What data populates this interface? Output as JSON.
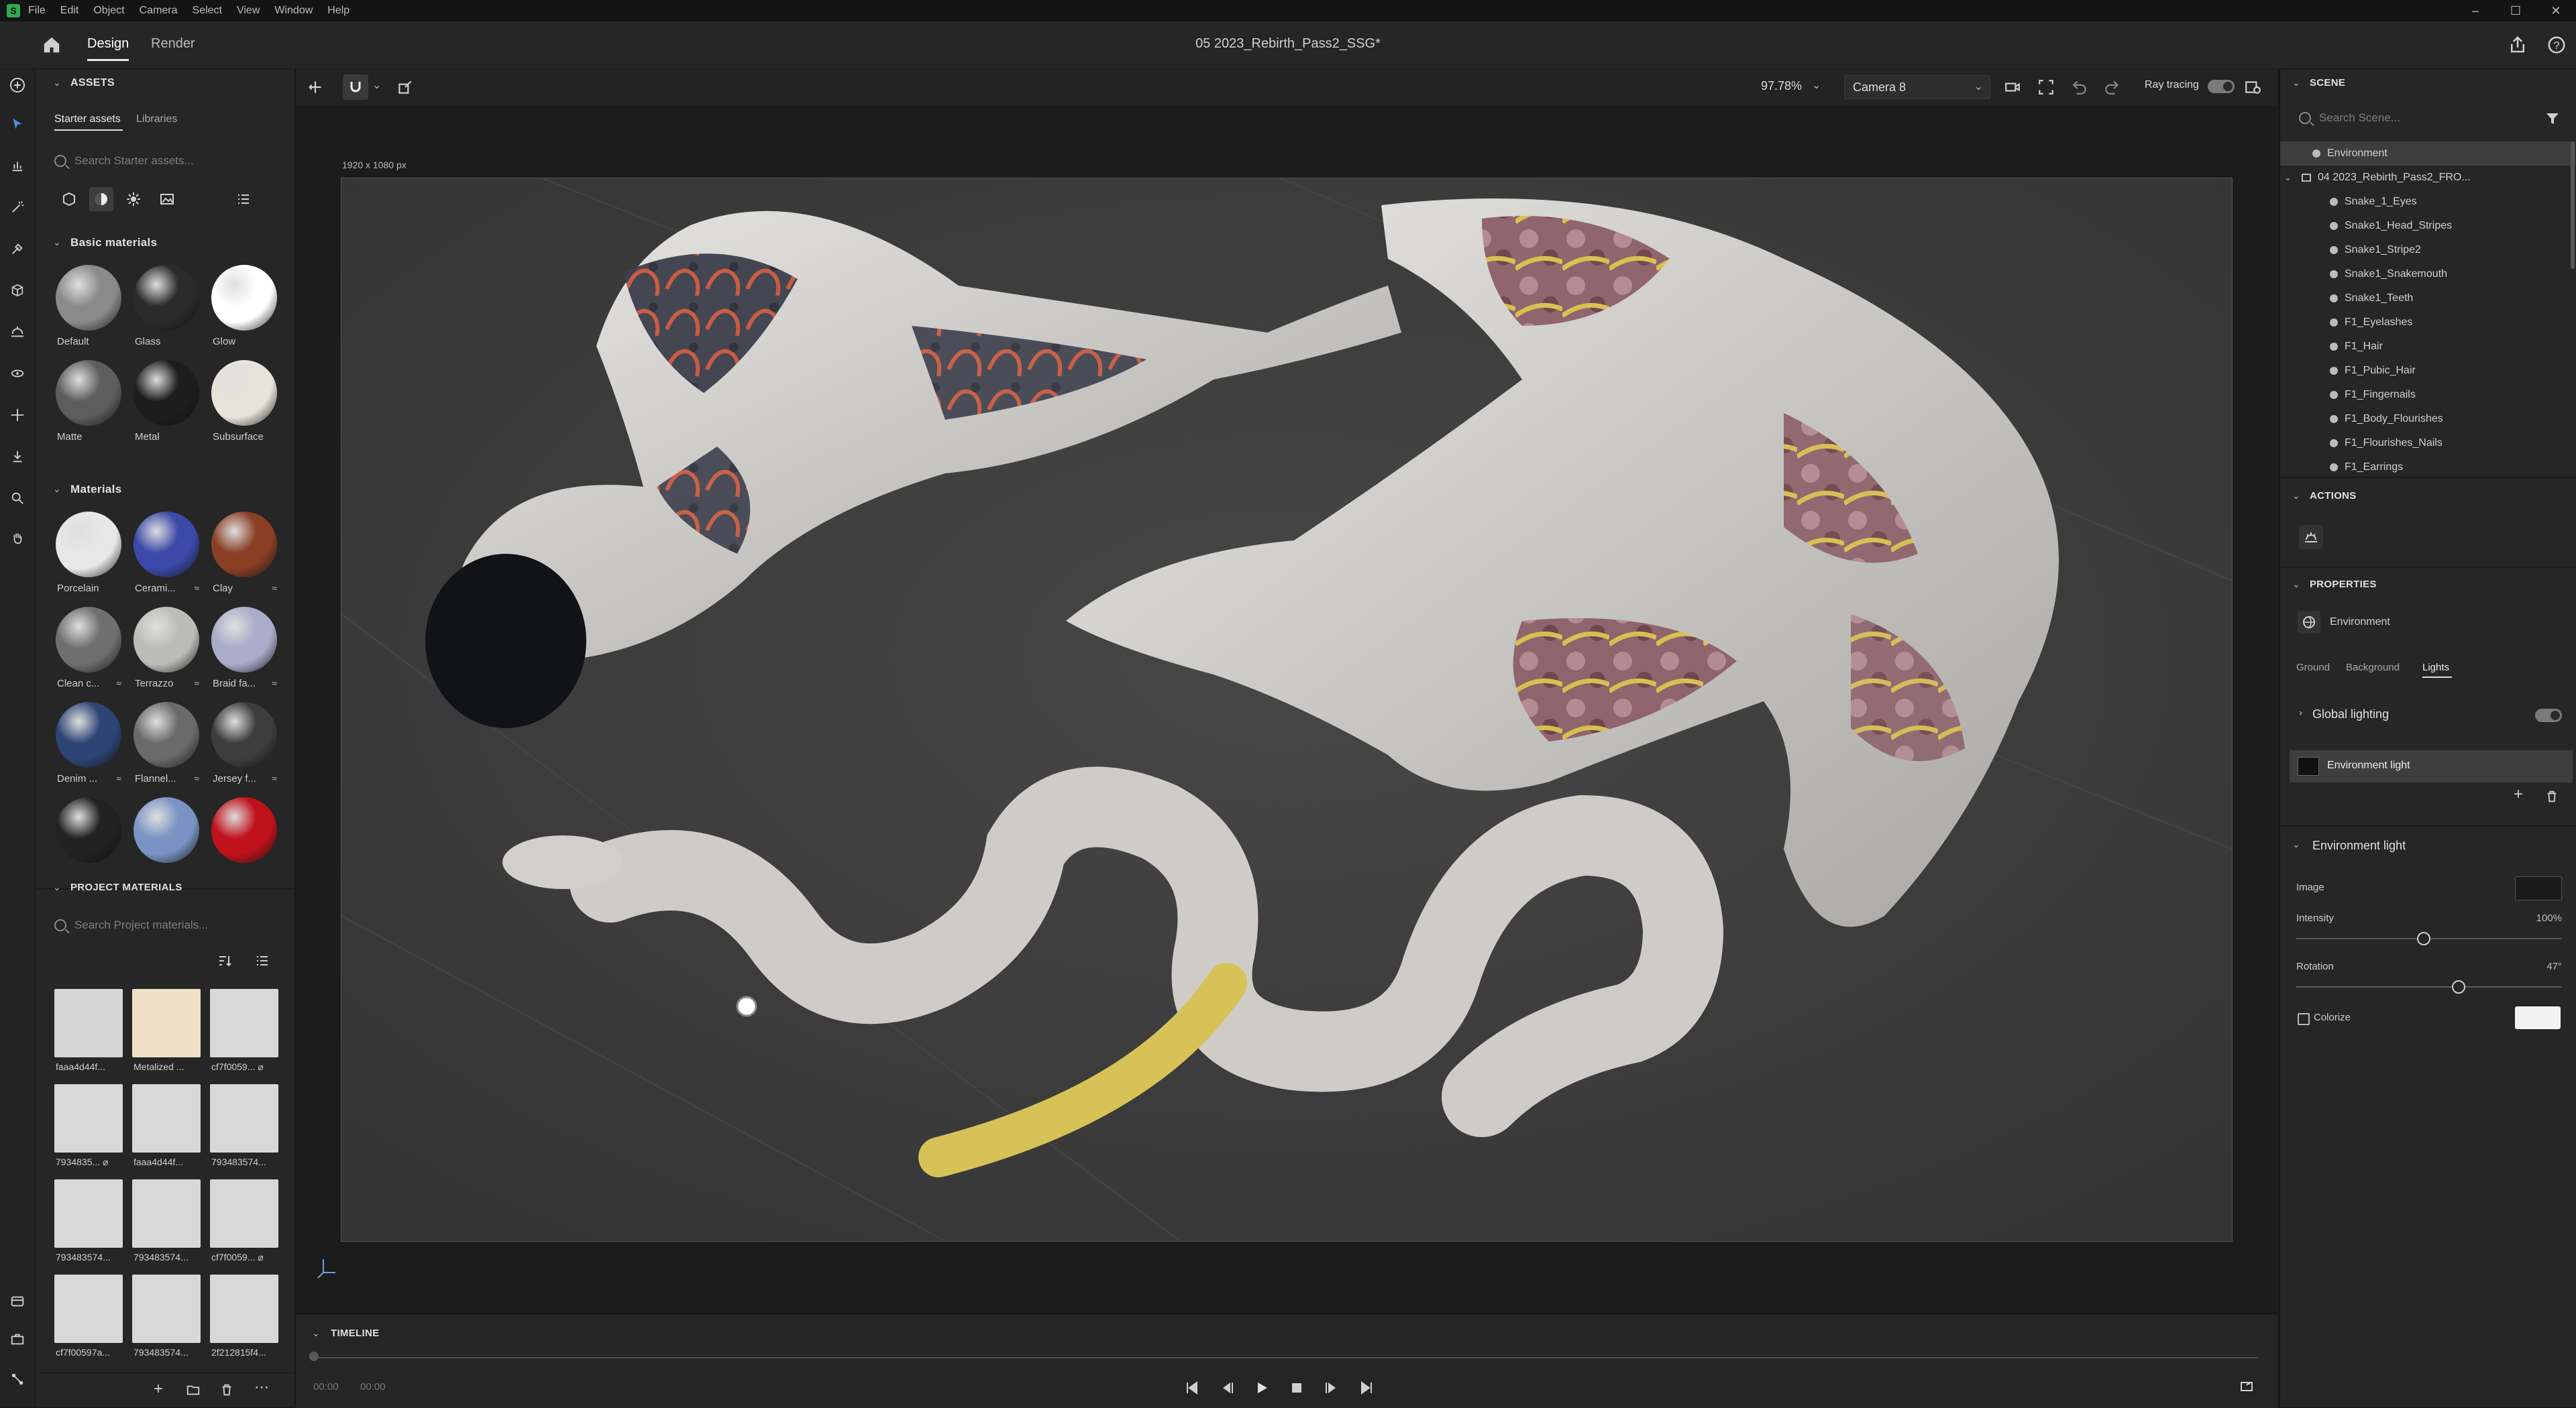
{
  "menubar": {
    "items": [
      "File",
      "Edit",
      "Object",
      "Camera",
      "Select",
      "View",
      "Window",
      "Help"
    ],
    "window_controls": [
      "minimize-icon",
      "maximize-icon",
      "close-icon"
    ]
  },
  "header": {
    "tabs": [
      "Design",
      "Render"
    ],
    "active_tab": "Design",
    "document_title": "05 2023_Rebirth_Pass2_SSG*"
  },
  "assets": {
    "title": "ASSETS",
    "tabs": [
      "Starter assets",
      "Libraries"
    ],
    "search_placeholder": "Search Starter assets...",
    "basic_title": "Basic materials",
    "basic": [
      {
        "label": "Default",
        "color": "#8a8a8a"
      },
      {
        "label": "Glass",
        "color": "#2b2b2b"
      },
      {
        "label": "Glow",
        "color": "#ffffff"
      },
      {
        "label": "Matte",
        "color": "#5d5d5d"
      },
      {
        "label": "Metal",
        "color": "#1d1d1d"
      },
      {
        "label": "Subsurface",
        "color": "#e8e3da"
      }
    ],
    "materials_title": "Materials",
    "materials": [
      {
        "label": "Porcelain",
        "color": "#e7e7e7",
        "mark": ""
      },
      {
        "label": "Cerami...",
        "color": "#3c49a8",
        "mark": "≈"
      },
      {
        "label": "Clay",
        "color": "#8a3f25",
        "mark": "≈"
      },
      {
        "label": "Clean c...",
        "color": "#6f6f6f",
        "mark": "≈"
      },
      {
        "label": "Terrazzo",
        "color": "#bdbdb8",
        "mark": "≈"
      },
      {
        "label": "Braid fa...",
        "color": "#a9adc9",
        "mark": "≈"
      },
      {
        "label": "Denim ...",
        "color": "#2d4575",
        "mark": "≈"
      },
      {
        "label": "Flannel...",
        "color": "#6a6a6a",
        "mark": "≈"
      },
      {
        "label": "Jersey f...",
        "color": "#3d3d3d",
        "mark": "≈"
      },
      {
        "label": "",
        "color": "#222222",
        "mark": ""
      },
      {
        "label": "",
        "color": "#7994c4",
        "mark": ""
      },
      {
        "label": "",
        "color": "#c0121c",
        "mark": ""
      }
    ],
    "project_title": "PROJECT MATERIALS",
    "project_search_placeholder": "Search Project materials...",
    "project": [
      {
        "label": "faaa4d44f...",
        "color": "#d6d6d6"
      },
      {
        "label": "Metalized ...",
        "color": "#efe0c6"
      },
      {
        "label": "cf7f0059... ⌀",
        "color": "#d8d8d8"
      },
      {
        "label": "7934835... ⌀",
        "color": "#d8d8d8"
      },
      {
        "label": "faaa4d44f...",
        "color": "#d8d8d8"
      },
      {
        "label": "793483574...",
        "color": "#d8d8d8"
      },
      {
        "label": "793483574...",
        "color": "#d8d8d8"
      },
      {
        "label": "793483574...",
        "color": "#d8d8d8"
      },
      {
        "label": "cf7f0059... ⌀",
        "color": "#d8d8d8"
      },
      {
        "label": "cf7f00597a...",
        "color": "#d8d8d8"
      },
      {
        "label": "793483574...",
        "color": "#d8d8d8"
      },
      {
        "label": "2f212815f4...",
        "color": "#d8d8d8"
      }
    ]
  },
  "viewport": {
    "zoom": "97.78%",
    "camera": "Camera 8",
    "ray_tracing_label": "Ray tracing",
    "canvas_size_label": "1920 x 1080 px"
  },
  "timeline": {
    "title": "TIMELINE",
    "time_current": "00:00",
    "time_total": "00:00"
  },
  "scene": {
    "title": "SCENE",
    "search_placeholder": "Search Scene...",
    "root": "Environment",
    "group": "04 2023_Rebirth_Pass2_FRO...",
    "items": [
      "Snake_1_Eyes",
      "Snake1_Head_Stripes",
      "Snake1_Stripe2",
      "Snake1_Snakemouth",
      "Snake1_Teeth",
      "F1_Eyelashes",
      "F1_Hair",
      "F1_Pubic_Hair",
      "F1_Fingernails",
      "F1_Body_Flourishes",
      "F1_Flourishes_Nails",
      "F1_Earrings"
    ]
  },
  "actions": {
    "title": "ACTIONS"
  },
  "properties": {
    "title": "PROPERTIES",
    "selected": "Environment",
    "tabs": [
      "Ground",
      "Background",
      "Lights"
    ],
    "active_tab": "Lights",
    "global_lighting": "Global lighting",
    "env_light_item": "Environment light",
    "env_section": "Environment light",
    "image_label": "Image",
    "intensity_label": "Intensity",
    "intensity_value": "100%",
    "intensity_fraction": 0.48,
    "rotation_label": "Rotation",
    "rotation_value": "47°",
    "rotation_fraction": 0.61,
    "colorize_label": "Colorize"
  }
}
